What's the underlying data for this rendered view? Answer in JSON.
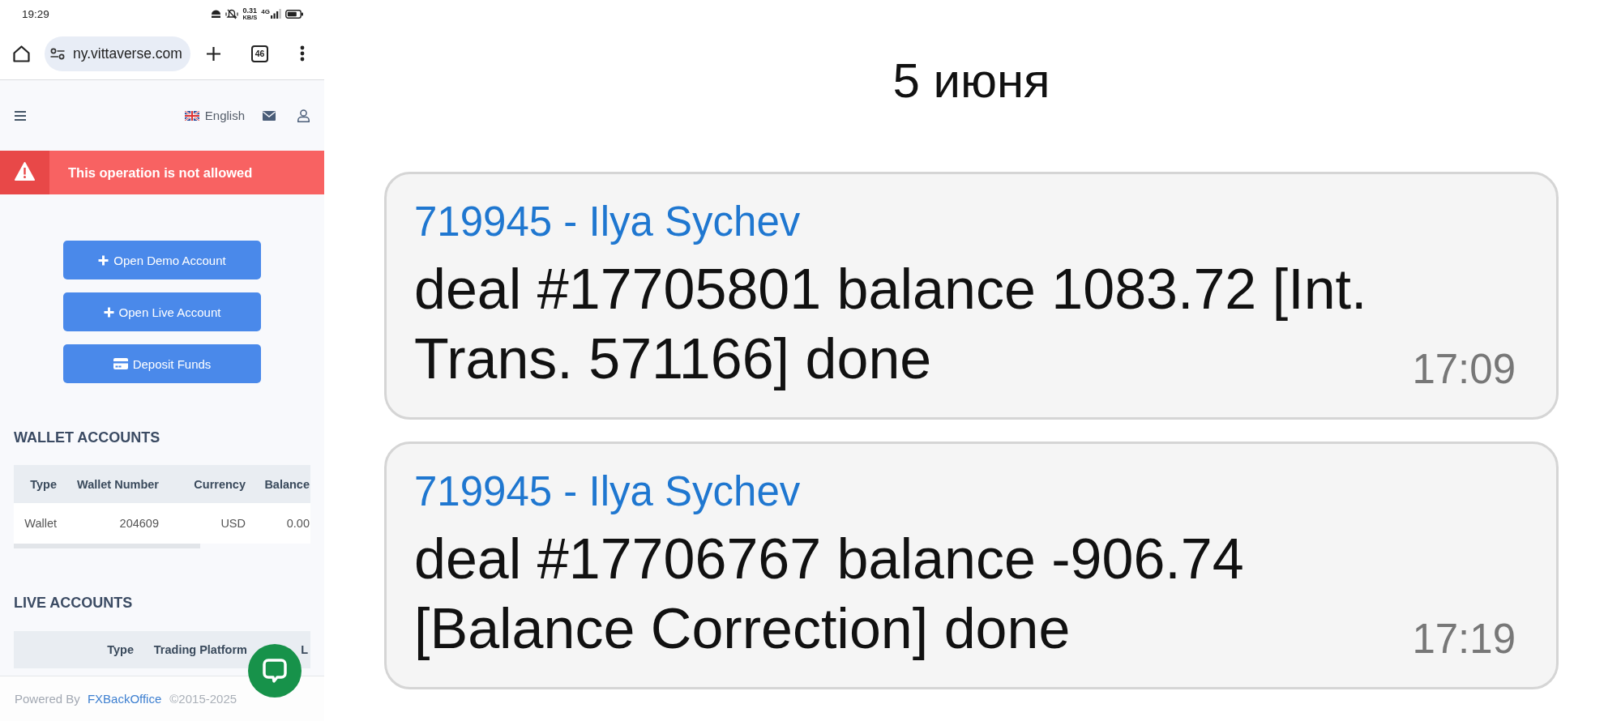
{
  "status_bar": {
    "time": "19:29",
    "speed_value": "0.31",
    "speed_unit": "KB/S",
    "network_type": "4G"
  },
  "browser": {
    "url": "ny.vittaverse.com",
    "tab_count": "46"
  },
  "nav": {
    "language": "English"
  },
  "alert": {
    "message": "This operation is not allowed"
  },
  "actions": [
    {
      "kind": "plus",
      "label": "Open Demo Account"
    },
    {
      "kind": "plus",
      "label": "Open Live Account"
    },
    {
      "kind": "card",
      "label": "Deposit Funds"
    }
  ],
  "wallet_accounts": {
    "title": "WALLET ACCOUNTS",
    "columns": [
      "Type",
      "Wallet Number",
      "Currency",
      "Balance"
    ],
    "rows": [
      [
        "Wallet",
        "204609",
        "USD",
        "0.00"
      ]
    ]
  },
  "live_accounts": {
    "title": "LIVE ACCOUNTS",
    "columns": [
      "Type",
      "Trading Platform",
      "L"
    ]
  },
  "footer": {
    "powered_by": "Powered By",
    "link": "FXBackOffice",
    "copyright": "©2015-2025"
  },
  "chat": {
    "date": "5 июня",
    "messages": [
      {
        "sender": "719945 - Ilya Sychev",
        "text": "deal #17705801 balance 1083.72 [Int. Trans. 571166] done",
        "time": "17:09"
      },
      {
        "sender": "719945 - Ilya Sychev",
        "text": "deal #17706767 balance -906.74 [Balance Correction] done",
        "time": "17:19"
      }
    ]
  }
}
